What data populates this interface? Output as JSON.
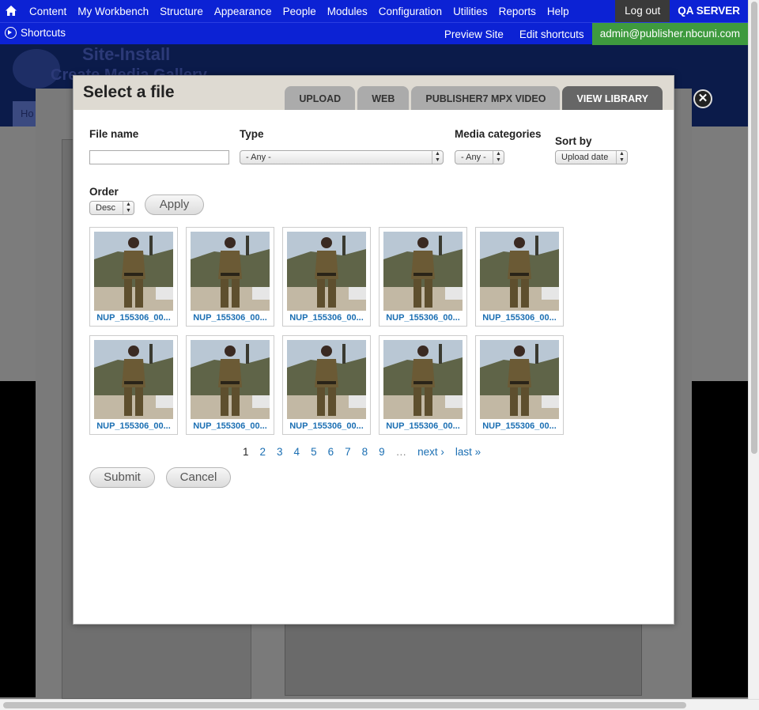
{
  "toolbar": {
    "menu": [
      "Content",
      "My Workbench",
      "Structure",
      "Appearance",
      "People",
      "Modules",
      "Configuration",
      "Utilities",
      "Reports",
      "Help"
    ],
    "logout": "Log out",
    "server": "QA SERVER",
    "shortcuts": "Shortcuts",
    "preview": "Preview Site",
    "edit_shortcuts": "Edit shortcuts",
    "user": "admin@publisher.nbcuni.com"
  },
  "background": {
    "site_name": "Site-Install",
    "page_title": "Create Media Gallery",
    "tab_label": "Ho"
  },
  "modal": {
    "title": "Select a file",
    "tabs": [
      {
        "label": "UPLOAD",
        "active": false
      },
      {
        "label": "WEB",
        "active": false
      },
      {
        "label": "PUBLISHER7 MPX VIDEO",
        "active": false
      },
      {
        "label": "VIEW LIBRARY",
        "active": true
      }
    ],
    "close": "✕",
    "filters": {
      "file_name_label": "File name",
      "file_name_value": "",
      "type_label": "Type",
      "type_value": "- Any -",
      "categories_label": "Media categories",
      "categories_value": "- Any -",
      "sort_label": "Sort by",
      "sort_value": "Upload date",
      "order_label": "Order",
      "order_value": "Desc",
      "apply": "Apply"
    },
    "files": [
      {
        "name": "NUP_155306_00..."
      },
      {
        "name": "NUP_155306_00..."
      },
      {
        "name": "NUP_155306_00..."
      },
      {
        "name": "NUP_155306_00..."
      },
      {
        "name": "NUP_155306_00..."
      },
      {
        "name": "NUP_155306_00..."
      },
      {
        "name": "NUP_155306_00..."
      },
      {
        "name": "NUP_155306_00..."
      },
      {
        "name": "NUP_155306_00..."
      },
      {
        "name": "NUP_155306_00..."
      }
    ],
    "pager": {
      "pages": [
        "1",
        "2",
        "3",
        "4",
        "5",
        "6",
        "7",
        "8",
        "9"
      ],
      "current": "1",
      "ellipsis": "…",
      "next": "next ›",
      "last": "last »"
    },
    "submit": "Submit",
    "cancel": "Cancel"
  },
  "colors": {
    "toolbar": "#0c22d4",
    "user_badge": "#3e9a3e",
    "link": "#1b6fb3",
    "active_tab": "#666666"
  }
}
